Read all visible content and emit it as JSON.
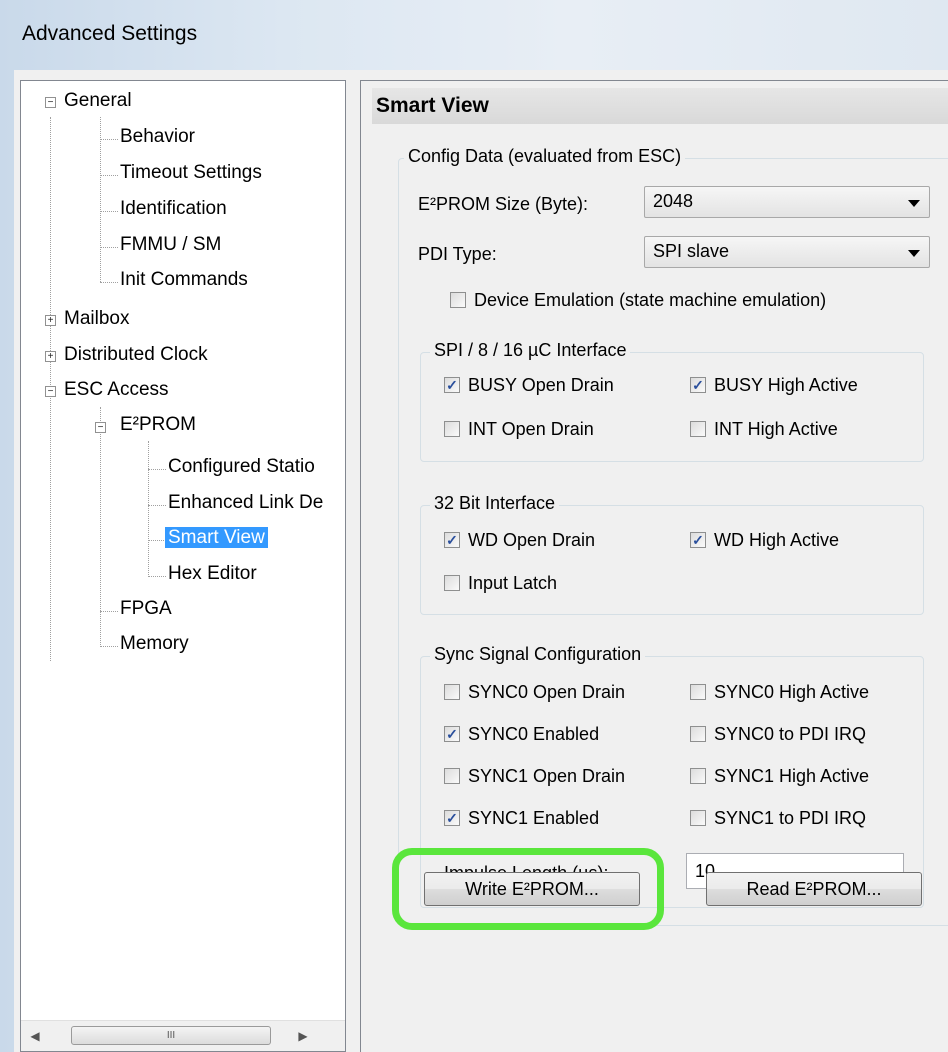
{
  "window": {
    "title": "Advanced Settings"
  },
  "tree": {
    "items": [
      {
        "label": "General"
      },
      {
        "label": "Behavior"
      },
      {
        "label": "Timeout Settings"
      },
      {
        "label": "Identification"
      },
      {
        "label": "FMMU / SM"
      },
      {
        "label": "Init Commands"
      },
      {
        "label": "Mailbox"
      },
      {
        "label": "Distributed Clock"
      },
      {
        "label": "ESC Access"
      },
      {
        "label": "E²PROM"
      },
      {
        "label": "Configured Statio"
      },
      {
        "label": "Enhanced Link De"
      },
      {
        "label": "Smart View"
      },
      {
        "label": "Hex Editor"
      },
      {
        "label": "FPGA"
      },
      {
        "label": "Memory"
      }
    ],
    "selected": "Smart View",
    "scroll_thumb": "III"
  },
  "panel": {
    "title": "Smart View",
    "config": {
      "title": "Config Data (evaluated from ESC)",
      "eeprom_size_label": "E²PROM Size (Byte):",
      "eeprom_size_value": "2048",
      "pdi_type_label": "PDI Type:",
      "pdi_type_value": "SPI slave",
      "device_emulation": {
        "label": "Device Emulation (state machine emulation)",
        "checked": false
      }
    },
    "spi": {
      "title": "SPI / 8 / 16 µC Interface",
      "busy_open_drain": {
        "label": "BUSY Open Drain",
        "checked": true
      },
      "busy_high_active": {
        "label": "BUSY High Active",
        "checked": true
      },
      "int_open_drain": {
        "label": "INT Open Drain",
        "checked": false
      },
      "int_high_active": {
        "label": "INT High Active",
        "checked": false
      }
    },
    "bit32": {
      "title": "32 Bit Interface",
      "wd_open_drain": {
        "label": "WD Open Drain",
        "checked": true
      },
      "wd_high_active": {
        "label": "WD High Active",
        "checked": true
      },
      "input_latch": {
        "label": "Input Latch",
        "checked": false
      }
    },
    "sync": {
      "title": "Sync Signal Configuration",
      "sync0_open_drain": {
        "label": "SYNC0 Open Drain",
        "checked": false
      },
      "sync0_high_active": {
        "label": "SYNC0 High Active",
        "checked": false
      },
      "sync0_enabled": {
        "label": "SYNC0 Enabled",
        "checked": true
      },
      "sync0_to_pdi": {
        "label": "SYNC0 to PDI IRQ",
        "checked": false
      },
      "sync1_open_drain": {
        "label": "SYNC1 Open Drain",
        "checked": false
      },
      "sync1_high_active": {
        "label": "SYNC1 High Active",
        "checked": false
      },
      "sync1_enabled": {
        "label": "SYNC1 Enabled",
        "checked": true
      },
      "sync1_to_pdi": {
        "label": "SYNC1 to PDI IRQ",
        "checked": false
      },
      "impulse_label": "Impulse Length (µs):",
      "impulse_value": "10"
    },
    "buttons": {
      "write": "Write E²PROM...",
      "read": "Read E²PROM..."
    },
    "highlight_color": "#5ae63c"
  },
  "check_glyph": "✓"
}
